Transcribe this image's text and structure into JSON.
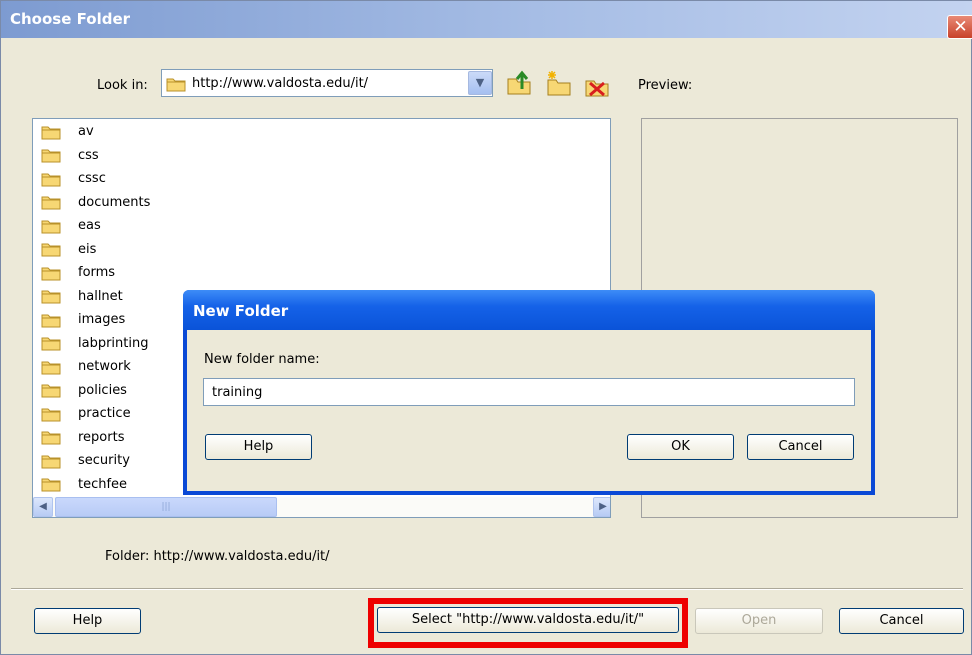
{
  "main": {
    "title": "Choose Folder",
    "close_glyph": "✕",
    "look_in_label": "Look in:",
    "look_in_value": "http://www.valdosta.edu/it/",
    "preview_label": "Preview:",
    "folders": [
      "av",
      "css",
      "cssc",
      "documents",
      "eas",
      "eis",
      "forms",
      "hallnet",
      "images",
      "labprinting",
      "network",
      "policies",
      "practice",
      "reports",
      "security",
      "techfee"
    ],
    "folder_label": "Folder:",
    "folder_path": "http://www.valdosta.edu/it/",
    "help_label": "Help",
    "select_label": "Select \"http://www.valdosta.edu/it/\"",
    "open_label": "Open",
    "cancel_label": "Cancel",
    "toolbar_icons": [
      "up-one-level-icon",
      "new-folder-icon",
      "delete-icon"
    ]
  },
  "dialog": {
    "title": "New Folder",
    "field_label": "New folder name:",
    "field_value": "training",
    "help_label": "Help",
    "ok_label": "OK",
    "cancel_label": "Cancel"
  },
  "colors": {
    "xp_blue": "#0a53d8",
    "highlight_red": "#ee0000",
    "dialog_bg": "#ece9d8"
  }
}
